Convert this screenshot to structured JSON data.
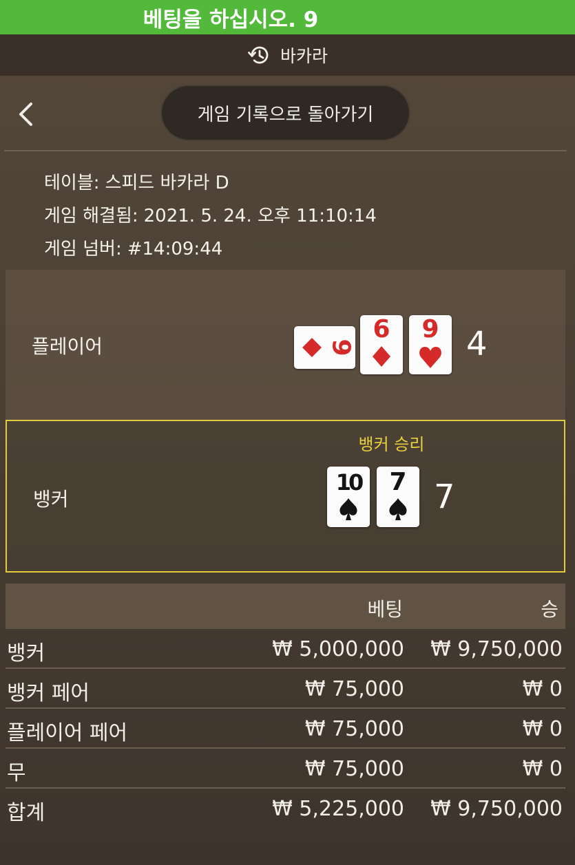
{
  "status_bar": {
    "text": "베팅을 하십시오. 9"
  },
  "header": {
    "title": "바카라",
    "icon": "history-icon"
  },
  "nav": {
    "back_icon": "chevron-left-icon",
    "history_button": "게임 기록으로 돌아가기"
  },
  "info": {
    "table_label": "테이블:",
    "table_value": "스피드 바카라 D",
    "resolved_label": "게임 해결됨:",
    "resolved_value": "2021. 5. 24. 오후 11:10:14",
    "number_label": "게임 넘버:",
    "number_value": "#14:09:44"
  },
  "player": {
    "label": "플레이어",
    "score": "4",
    "cards": [
      {
        "rank": "9",
        "suit": "diamond",
        "color": "#d42a2a",
        "rotated": true
      },
      {
        "rank": "6",
        "suit": "diamond",
        "color": "#d42a2a",
        "rotated": false
      },
      {
        "rank": "9",
        "suit": "heart",
        "color": "#d42a2a",
        "rotated": false
      }
    ]
  },
  "banker": {
    "label": "뱅커",
    "score": "7",
    "win_label": "뱅커 승리",
    "highlight_color": "#e4cd3c",
    "cards": [
      {
        "rank": "10",
        "suit": "spade",
        "color": "#141414"
      },
      {
        "rank": "7",
        "suit": "spade",
        "color": "#141414"
      }
    ]
  },
  "bets": {
    "header_bet": "베팅",
    "header_win": "승",
    "rows": [
      {
        "name": "뱅커",
        "bet": "₩ 5,000,000",
        "win": "₩ 9,750,000"
      },
      {
        "name": "뱅커 페어",
        "bet": "₩ 75,000",
        "win": "₩ 0"
      },
      {
        "name": "플레이어 페어",
        "bet": "₩ 75,000",
        "win": "₩ 0"
      },
      {
        "name": "무",
        "bet": "₩ 75,000",
        "win": "₩ 0"
      },
      {
        "name": "합계",
        "bet": "₩ 5,225,000",
        "win": "₩ 9,750,000"
      }
    ]
  },
  "colors": {
    "status_green": "#53b93b",
    "win_yellow": "#e8cf3c",
    "card_red": "#d42a2a"
  }
}
